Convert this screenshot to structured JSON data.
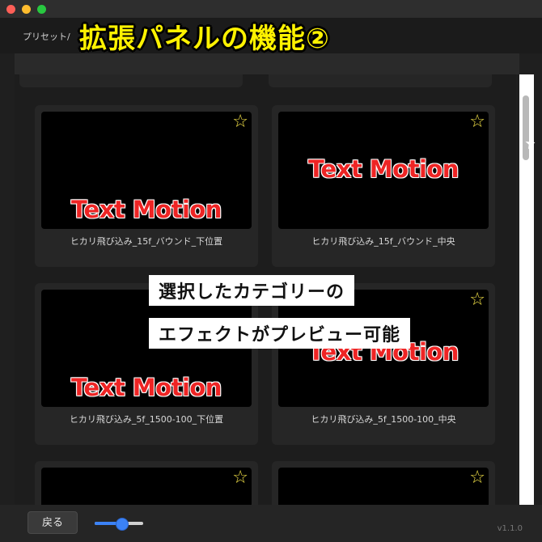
{
  "window": {
    "headline": "拡張パネルの機能②"
  },
  "toolbar": {
    "tab_label": "プリセット/",
    "menu_glyph": "☰"
  },
  "grid": {
    "cards": [
      {
        "caption": "ヒカリ飛び込み_15f_バウンド_下位置",
        "thumb_text": "Text Motion",
        "starred": false
      },
      {
        "caption": "ヒカリ飛び込み_15f_バウンド_中央",
        "thumb_text": "Text Motion",
        "starred": false
      },
      {
        "caption": "ヒカリ飛び込み_5f_1500-100_下位置",
        "thumb_text": "Text Motion",
        "starred": false
      },
      {
        "caption": "ヒカリ飛び込み_5f_1500-100_中央",
        "thumb_text": "Text Motion",
        "starred": false
      }
    ],
    "star_glyph": "☆"
  },
  "overlay": {
    "line1": "選択したカテゴリーの",
    "line2": "エフェクトがプレビュー可能"
  },
  "footer": {
    "back_label": "戻る",
    "zoom_level": 0.55,
    "version": "v1.1.0"
  },
  "colors": {
    "accent": "#3b82f6",
    "star": "#f2e047",
    "motion_text": "#ee2424"
  }
}
